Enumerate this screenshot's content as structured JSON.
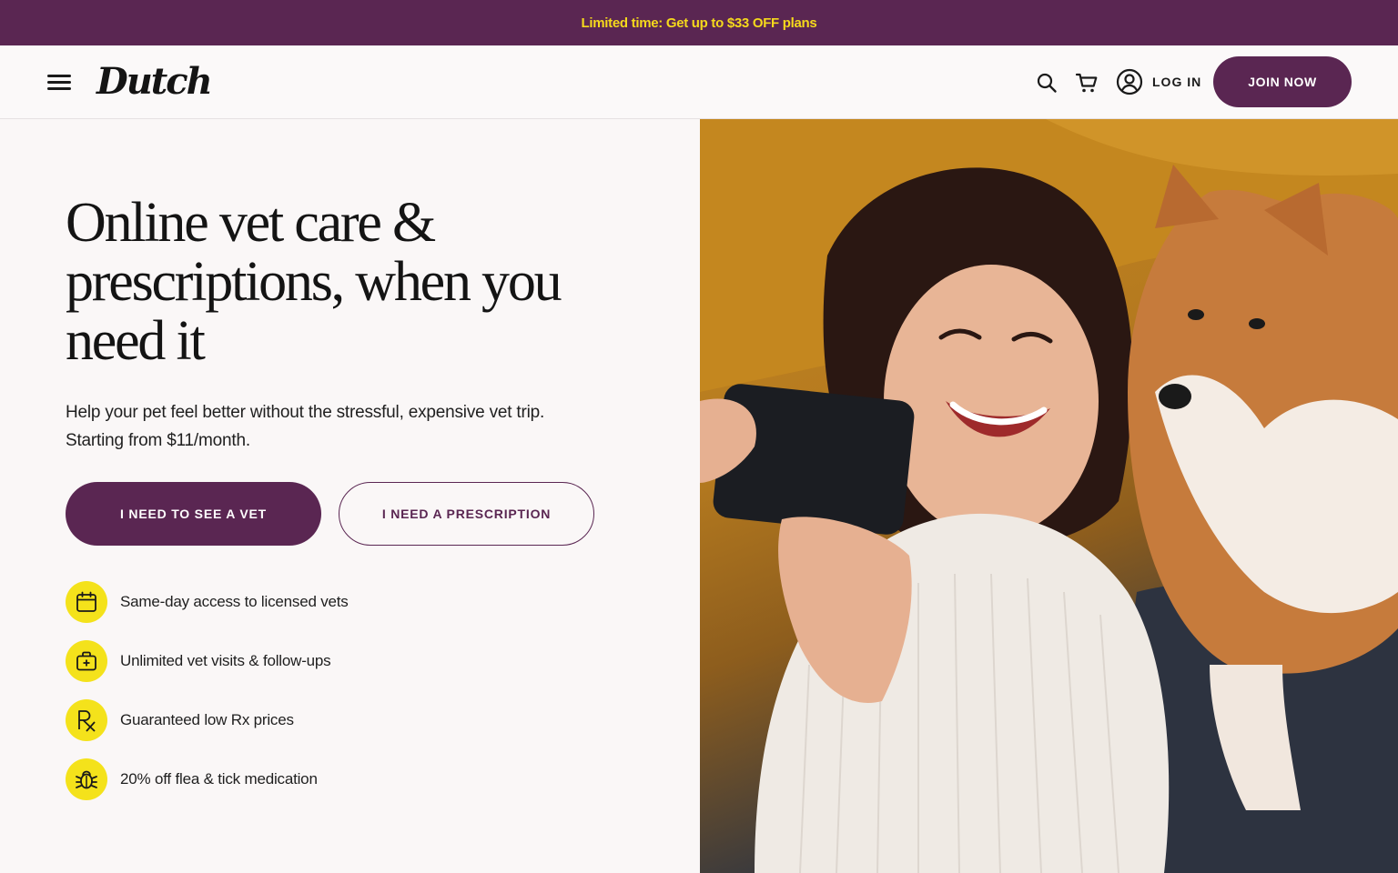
{
  "promo": {
    "text": "Limited time: Get up to $33 OFF plans"
  },
  "header": {
    "logo": "Dutch",
    "login_label": "LOG IN",
    "join_label": "JOIN NOW",
    "icons": [
      "menu-icon",
      "search-icon",
      "cart-icon",
      "account-icon"
    ]
  },
  "hero": {
    "title": "Online vet care & prescriptions, when you need it",
    "subtitle_line1": "Help your pet feel better without the stressful, expensive vet trip.",
    "subtitle_line2": "Starting from $11/month.",
    "cta_primary": "I NEED TO SEE A VET",
    "cta_secondary": "I NEED A PRESCRIPTION",
    "features": [
      {
        "icon": "calendar-icon",
        "label": "Same-day access to licensed vets"
      },
      {
        "icon": "medical-kit-icon",
        "label": "Unlimited vet visits & follow-ups"
      },
      {
        "icon": "rx-icon",
        "label": "Guaranteed low Rx prices"
      },
      {
        "icon": "bug-icon",
        "label": "20% off flea & tick medication"
      }
    ]
  },
  "colors": {
    "brand": "#5a2652",
    "accent": "#f4e21b",
    "promo_text": "#f5d91c"
  }
}
